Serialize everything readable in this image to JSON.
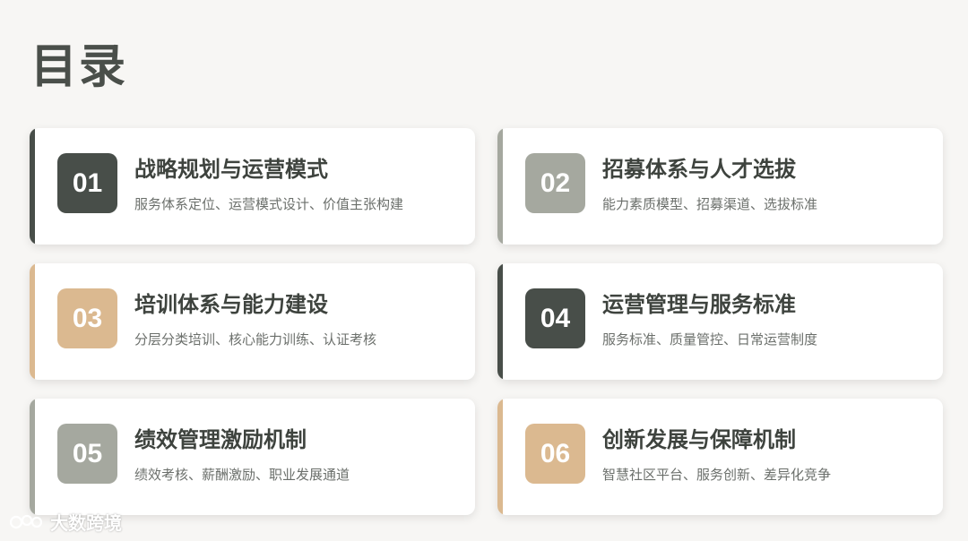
{
  "page": {
    "title": "目录"
  },
  "items": [
    {
      "number": "01",
      "title": "战略规划与运营模式",
      "desc": "服务体系定位、运营模式设计、价值主张构建",
      "accent": "#484e49"
    },
    {
      "number": "02",
      "title": "招募体系与人才选拔",
      "desc": "能力素质模型、招募渠道、选拔标准",
      "accent": "#a5a89f"
    },
    {
      "number": "03",
      "title": "培训体系与能力建设",
      "desc": "分层分类培训、核心能力训练、认证考核",
      "accent": "#dbb990"
    },
    {
      "number": "04",
      "title": "运营管理与服务标准",
      "desc": "服务标准、质量管控、日常运营制度",
      "accent": "#484e49"
    },
    {
      "number": "05",
      "title": "绩效管理激励机制",
      "desc": "绩效考核、薪酬激励、职业发展通道",
      "accent": "#a5a89f"
    },
    {
      "number": "06",
      "title": "创新发展与保障机制",
      "desc": "智慧社区平台、服务创新、差异化竞争",
      "accent": "#dbb990"
    }
  ],
  "watermark": {
    "text": "大数跨境",
    "icon": "logo-icon"
  }
}
